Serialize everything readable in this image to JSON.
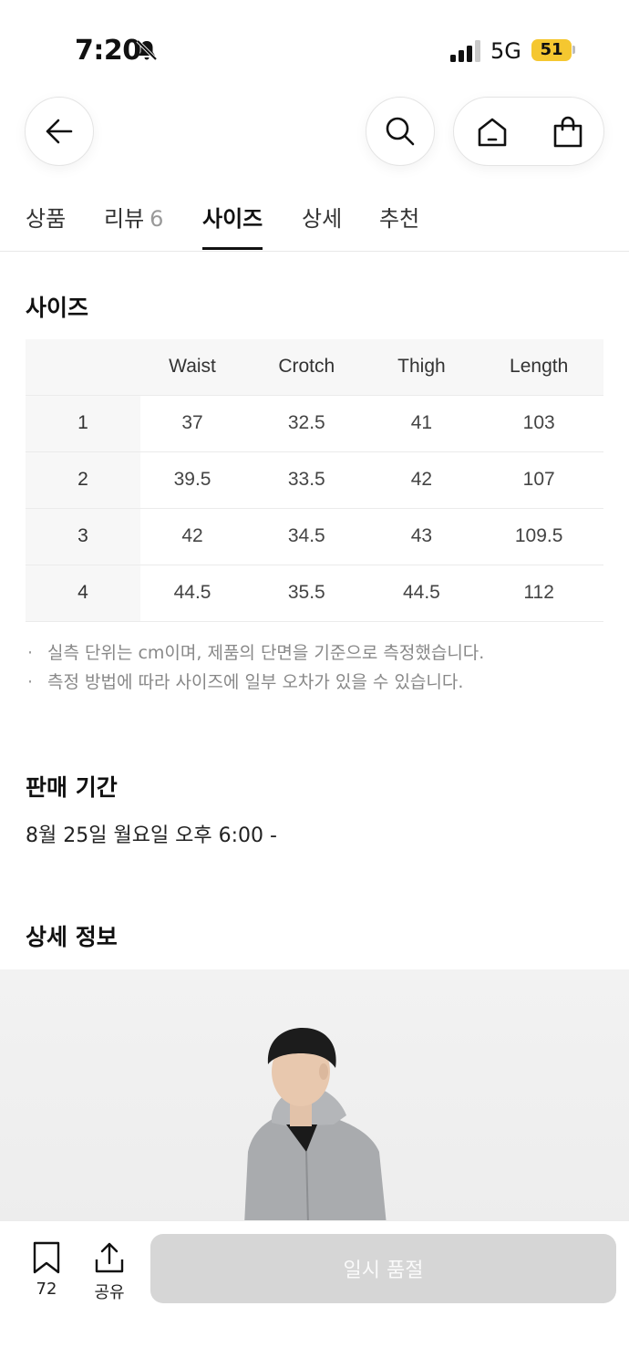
{
  "status_bar": {
    "time": "7:20",
    "network": "5G",
    "battery": "51"
  },
  "tabs": [
    {
      "label": "상품",
      "count": ""
    },
    {
      "label": "리뷰",
      "count": "6"
    },
    {
      "label": "사이즈",
      "count": ""
    },
    {
      "label": "상세",
      "count": ""
    },
    {
      "label": "추천",
      "count": ""
    }
  ],
  "active_tab": "사이즈",
  "size_section": {
    "title": "사이즈",
    "columns": [
      "Waist",
      "Crotch",
      "Thigh",
      "Length"
    ],
    "rows": [
      {
        "size": "1",
        "values": [
          "37",
          "32.5",
          "41",
          "103"
        ]
      },
      {
        "size": "2",
        "values": [
          "39.5",
          "33.5",
          "42",
          "107"
        ]
      },
      {
        "size": "3",
        "values": [
          "42",
          "34.5",
          "43",
          "109.5"
        ]
      },
      {
        "size": "4",
        "values": [
          "44.5",
          "35.5",
          "44.5",
          "112"
        ]
      }
    ],
    "notes": [
      "실측 단위는 cm이며, 제품의 단면을 기준으로 측정했습니다.",
      "측정 방법에 따라 사이즈에 일부 오차가 있을 수 있습니다."
    ]
  },
  "sale_period": {
    "title": "판매 기간",
    "text": "8월 25일 월요일 오후 6:00 -"
  },
  "detail_info": {
    "title": "상세 정보"
  },
  "bottom_bar": {
    "bookmark_count": "72",
    "share_label": "공유",
    "soldout_label": "일시 품절"
  },
  "icons": [
    "bell-slash-icon",
    "back-arrow-icon",
    "search-icon",
    "home-icon",
    "shopping-bag-icon",
    "bookmark-icon",
    "share-icon"
  ],
  "colors": {
    "battery": "#f5c730",
    "soldout_button": "#d6d6d6"
  }
}
